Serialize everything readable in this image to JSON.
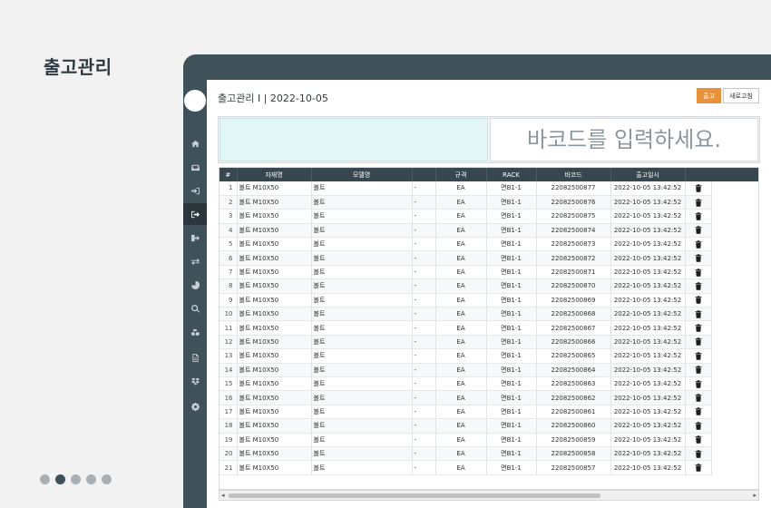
{
  "page_heading": "출고관리",
  "window": {
    "title": "출고관리 I | 2022-10-05",
    "buttons": {
      "out": "출고",
      "refresh": "새로고침"
    }
  },
  "scan": {
    "placeholder": "바코드를 입력하세요."
  },
  "sidebar": {
    "items": [
      {
        "icon": "home-icon"
      },
      {
        "icon": "inbox-icon"
      },
      {
        "icon": "sign-in-icon"
      },
      {
        "icon": "sign-out-icon",
        "active": true
      },
      {
        "icon": "export-icon"
      },
      {
        "icon": "exchange-icon"
      },
      {
        "icon": "pie-chart-icon"
      },
      {
        "icon": "search-plus-icon"
      },
      {
        "icon": "cubes-icon"
      },
      {
        "icon": "file-icon"
      },
      {
        "icon": "dropbox-icon"
      },
      {
        "icon": "gear-icon"
      }
    ]
  },
  "table": {
    "columns": [
      "#",
      "자재명",
      "모델명",
      "",
      "규격",
      "RACK",
      "바코드",
      "출고일시",
      ""
    ],
    "rows": [
      {
        "no": "1",
        "name": "볼트 M10X50",
        "model": "볼트",
        "spec": "-",
        "unit": "EA",
        "rack": "면B1-1",
        "barcode": "22082500877",
        "date": "2022-10-05 13:42:52"
      },
      {
        "no": "2",
        "name": "볼트 M10X50",
        "model": "볼트",
        "spec": "-",
        "unit": "EA",
        "rack": "면B1-1",
        "barcode": "22082500876",
        "date": "2022-10-05 13:42:52"
      },
      {
        "no": "3",
        "name": "볼트 M10X50",
        "model": "볼트",
        "spec": "-",
        "unit": "EA",
        "rack": "면B1-1",
        "barcode": "22082500875",
        "date": "2022-10-05 13:42:52"
      },
      {
        "no": "4",
        "name": "볼트 M10X50",
        "model": "볼트",
        "spec": "-",
        "unit": "EA",
        "rack": "면B1-1",
        "barcode": "22082500874",
        "date": "2022-10-05 13:42:52"
      },
      {
        "no": "5",
        "name": "볼트 M10X50",
        "model": "볼트",
        "spec": "-",
        "unit": "EA",
        "rack": "면B1-1",
        "barcode": "22082500873",
        "date": "2022-10-05 13:42:52"
      },
      {
        "no": "6",
        "name": "볼트 M10X50",
        "model": "볼트",
        "spec": "-",
        "unit": "EA",
        "rack": "면B1-1",
        "barcode": "22082500872",
        "date": "2022-10-05 13:42:52"
      },
      {
        "no": "7",
        "name": "볼트 M10X50",
        "model": "볼트",
        "spec": "-",
        "unit": "EA",
        "rack": "면B1-1",
        "barcode": "22082500871",
        "date": "2022-10-05 13:42:52"
      },
      {
        "no": "8",
        "name": "볼트 M10X50",
        "model": "볼트",
        "spec": "-",
        "unit": "EA",
        "rack": "면B1-1",
        "barcode": "22082500870",
        "date": "2022-10-05 13:42:52"
      },
      {
        "no": "9",
        "name": "볼트 M10X50",
        "model": "볼트",
        "spec": "-",
        "unit": "EA",
        "rack": "면B1-1",
        "barcode": "22082500869",
        "date": "2022-10-05 13:42:52"
      },
      {
        "no": "10",
        "name": "볼트 M10X50",
        "model": "볼트",
        "spec": "-",
        "unit": "EA",
        "rack": "면B1-1",
        "barcode": "22082500868",
        "date": "2022-10-05 13:42:52"
      },
      {
        "no": "11",
        "name": "볼트 M10X50",
        "model": "볼트",
        "spec": "-",
        "unit": "EA",
        "rack": "면B1-1",
        "barcode": "22082500867",
        "date": "2022-10-05 13:42:52"
      },
      {
        "no": "12",
        "name": "볼트 M10X50",
        "model": "볼트",
        "spec": "-",
        "unit": "EA",
        "rack": "면B1-1",
        "barcode": "22082500866",
        "date": "2022-10-05 13:42:52"
      },
      {
        "no": "13",
        "name": "볼트 M10X50",
        "model": "볼트",
        "spec": "-",
        "unit": "EA",
        "rack": "면B1-1",
        "barcode": "22082500865",
        "date": "2022-10-05 13:42:52"
      },
      {
        "no": "14",
        "name": "볼트 M10X50",
        "model": "볼트",
        "spec": "-",
        "unit": "EA",
        "rack": "면B1-1",
        "barcode": "22082500864",
        "date": "2022-10-05 13:42:52"
      },
      {
        "no": "15",
        "name": "볼트 M10X50",
        "model": "볼트",
        "spec": "-",
        "unit": "EA",
        "rack": "면B1-1",
        "barcode": "22082500863",
        "date": "2022-10-05 13:42:52"
      },
      {
        "no": "16",
        "name": "볼트 M10X50",
        "model": "볼트",
        "spec": "-",
        "unit": "EA",
        "rack": "면B1-1",
        "barcode": "22082500862",
        "date": "2022-10-05 13:42:52"
      },
      {
        "no": "17",
        "name": "볼트 M10X50",
        "model": "볼트",
        "spec": "-",
        "unit": "EA",
        "rack": "면B1-1",
        "barcode": "22082500861",
        "date": "2022-10-05 13:42:52"
      },
      {
        "no": "18",
        "name": "볼트 M10X50",
        "model": "볼트",
        "spec": "-",
        "unit": "EA",
        "rack": "면B1-1",
        "barcode": "22082500860",
        "date": "2022-10-05 13:42:52"
      },
      {
        "no": "19",
        "name": "볼트 M10X50",
        "model": "볼트",
        "spec": "-",
        "unit": "EA",
        "rack": "면B1-1",
        "barcode": "22082500859",
        "date": "2022-10-05 13:42:52"
      },
      {
        "no": "20",
        "name": "볼트 M10X50",
        "model": "볼트",
        "spec": "-",
        "unit": "EA",
        "rack": "면B1-1",
        "barcode": "22082500858",
        "date": "2022-10-05 13:42:52"
      },
      {
        "no": "21",
        "name": "볼트 M10X50",
        "model": "볼트",
        "spec": "-",
        "unit": "EA",
        "rack": "면B1-1",
        "barcode": "22082500857",
        "date": "2022-10-05 13:42:52"
      }
    ]
  },
  "pager": {
    "count": 5,
    "active": 1
  },
  "colors": {
    "accent": "#e9923a",
    "sidebar": "#3f5159",
    "header": "#37474f",
    "scan_bg": "#e2f6f6"
  }
}
